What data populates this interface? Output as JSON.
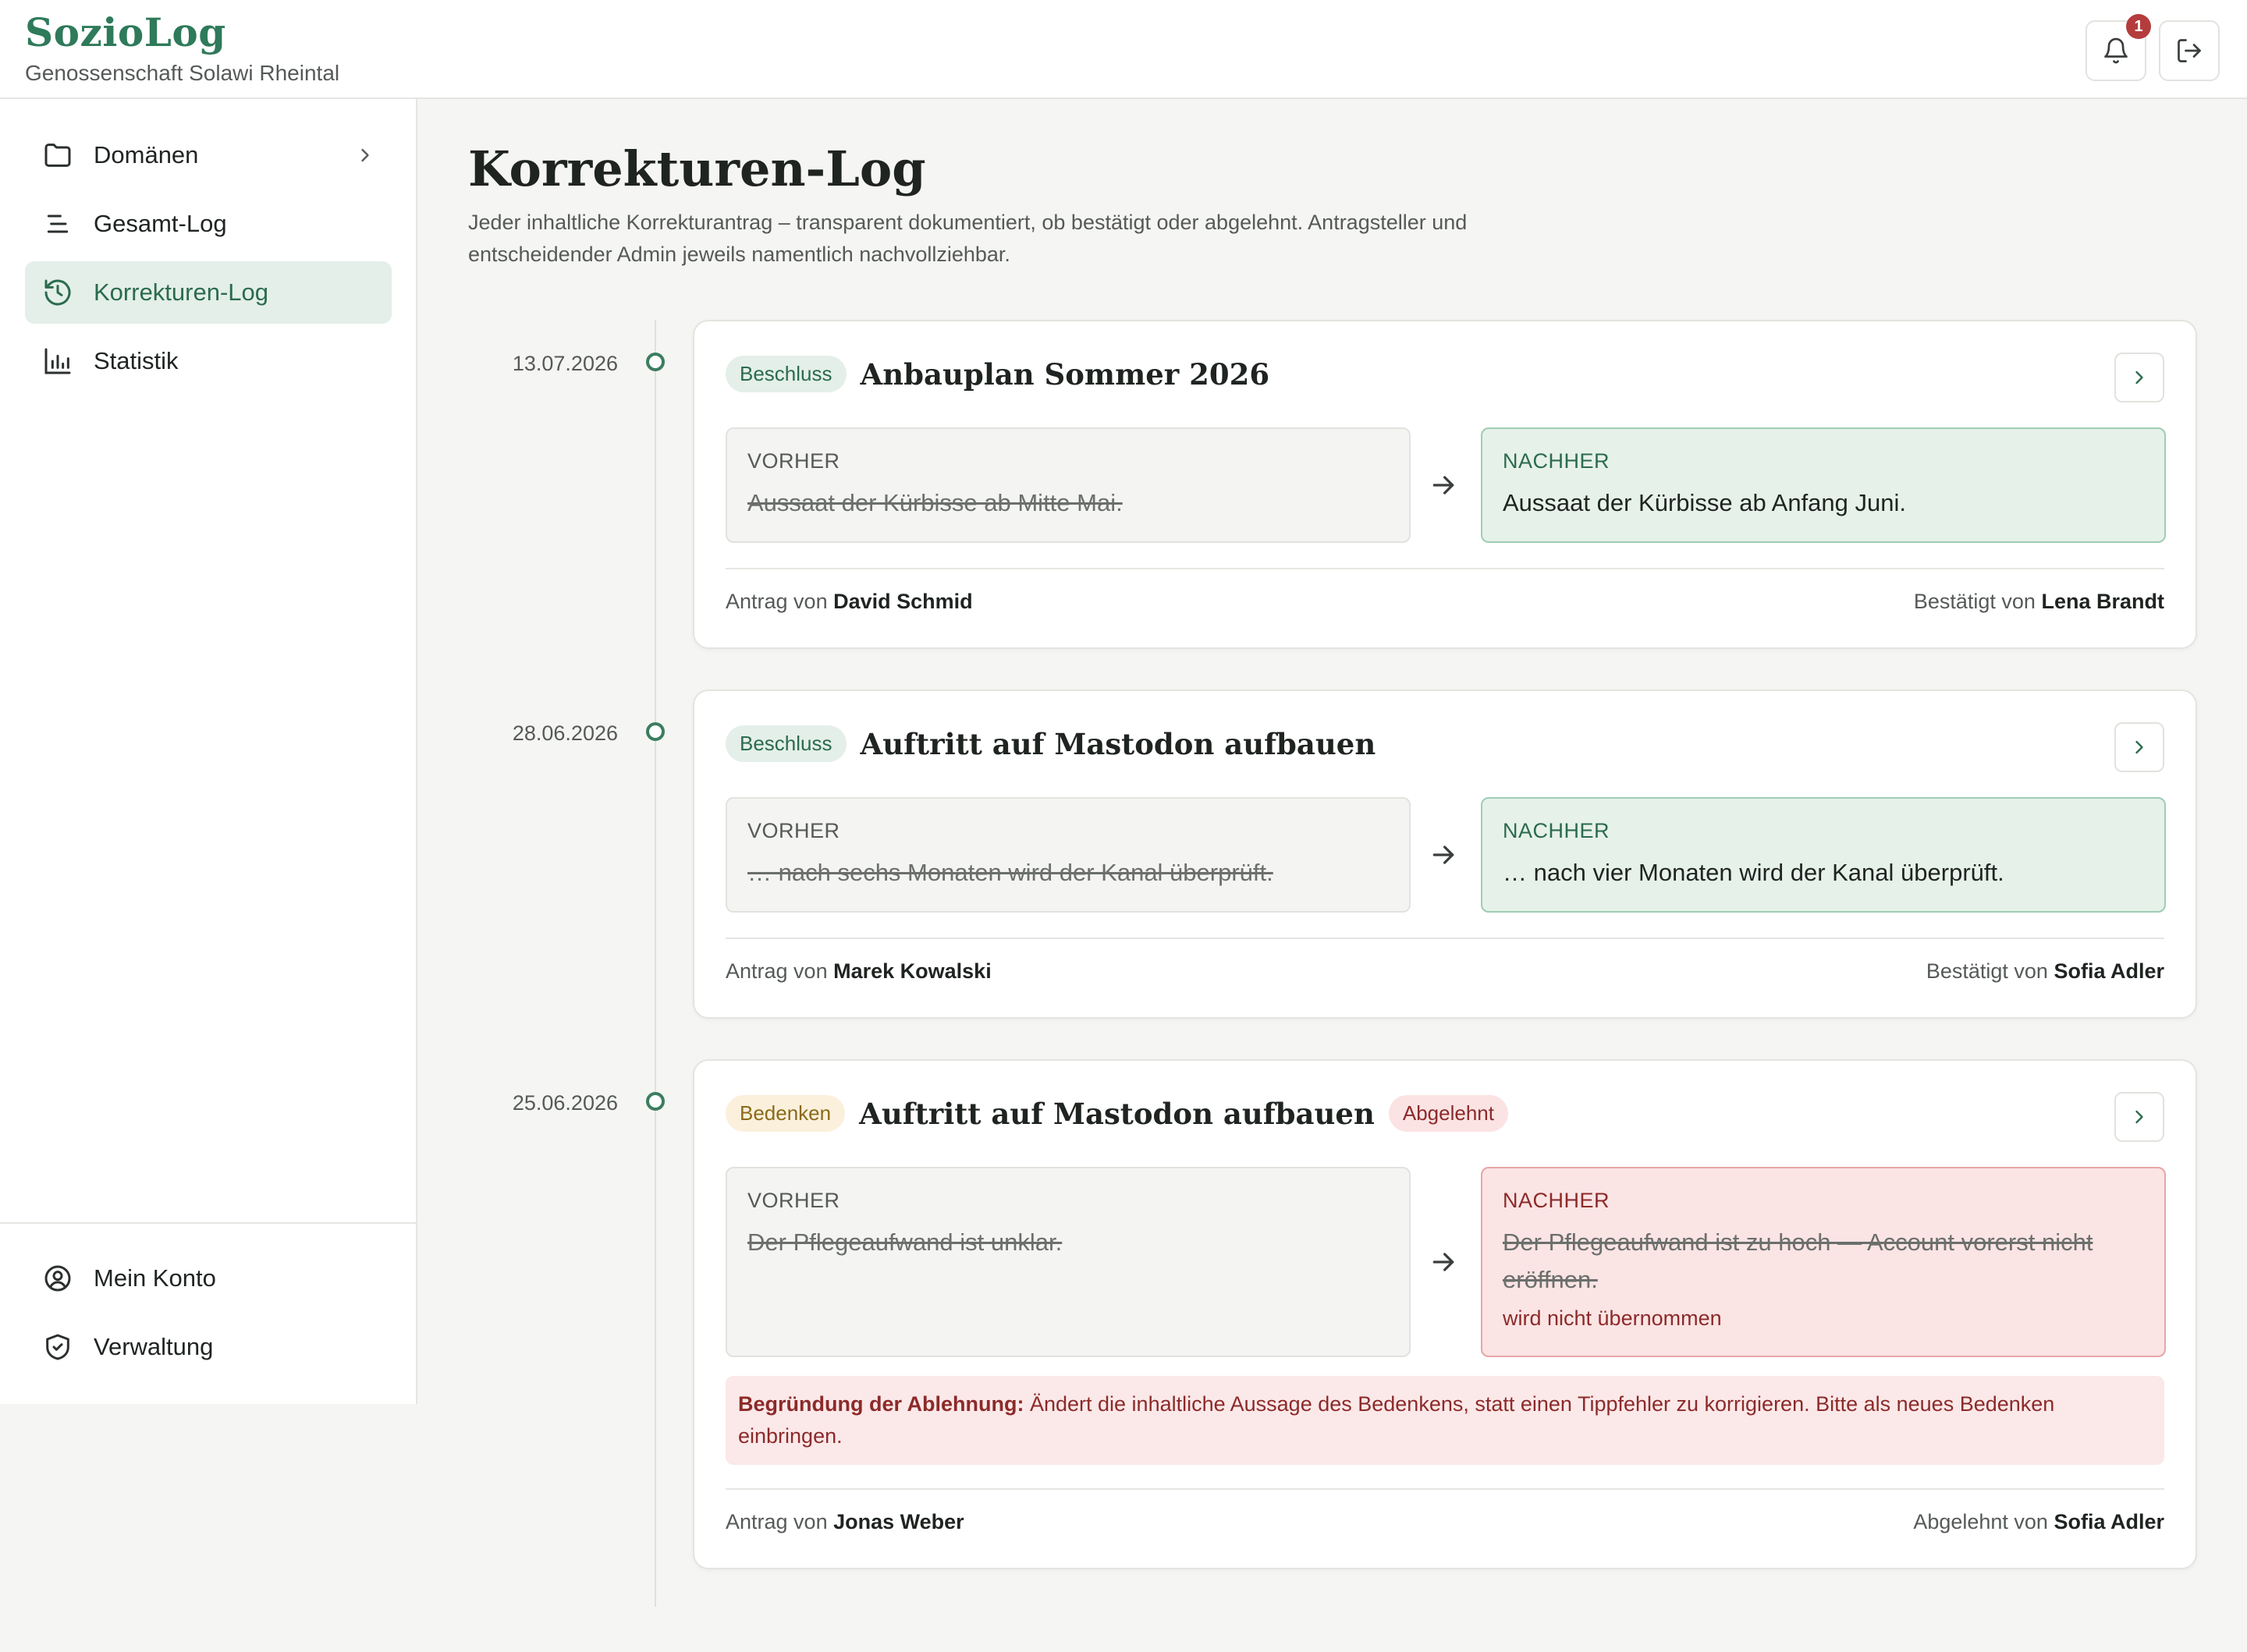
{
  "app": {
    "name": "SozioLog",
    "organization": "Genossenschaft Solawi Rheintal",
    "notification_count": "1"
  },
  "sidebar": {
    "items": [
      {
        "label": "Domänen",
        "icon": "folder-icon"
      },
      {
        "label": "Gesamt-Log",
        "icon": "list-lines-icon"
      },
      {
        "label": "Korrekturen-Log",
        "icon": "history-icon",
        "active": true
      },
      {
        "label": "Statistik",
        "icon": "bar-chart-icon"
      }
    ],
    "bottom_items": [
      {
        "label": "Mein Konto",
        "icon": "user-circle-icon"
      },
      {
        "label": "Verwaltung",
        "icon": "shield-check-icon"
      }
    ]
  },
  "main": {
    "title": "Korrekturen-Log",
    "description": "Jeder inhaltliche Korrekturantrag – transparent dokumentiert, ob bestätigt oder abgelehnt. Antragsteller und entscheidender Admin jeweils namentlich nachvollziehbar.",
    "labels": {
      "before": "VORHER",
      "after": "NACHHER",
      "requested_by": "Antrag von",
      "confirmed_by": "Bestätigt von",
      "rejected_by": "Abgelehnt von",
      "not_applied": "wird nicht übernommen",
      "rejection_reason_label": "Begründung der Ablehnung:"
    },
    "entries": [
      {
        "date": "13.07.2026",
        "type": "Beschluss",
        "title": "Anbauplan Sommer 2026",
        "before": "Aussaat der Kürbisse ab Mitte Mai.",
        "after": "Aussaat der Kürbisse ab Anfang Juni.",
        "requester": "David Schmid",
        "decider": "Lena Brandt",
        "status": "confirmed"
      },
      {
        "date": "28.06.2026",
        "type": "Beschluss",
        "title": "Auftritt auf Mastodon aufbauen",
        "before": "… nach sechs Monaten wird der Kanal überprüft.",
        "after": "… nach vier Monaten wird der Kanal überprüft.",
        "requester": "Marek Kowalski",
        "decider": "Sofia Adler",
        "status": "confirmed"
      },
      {
        "date": "25.06.2026",
        "type": "Bedenken",
        "title": "Auftritt auf Mastodon aufbauen",
        "status_badge": "Abgelehnt",
        "before": "Der Pflegeaufwand ist unklar.",
        "after": "Der Pflegeaufwand ist zu hoch — Account vorerst nicht eröffnen.",
        "rejection_reason": "Ändert die inhaltliche Aussage des Bedenkens, statt einen Tippfehler zu korrigieren. Bitte als neues Bedenken einbringen.",
        "requester": "Jonas Weber",
        "decider": "Sofia Adler",
        "status": "rejected"
      }
    ]
  },
  "colors": {
    "brand": "#2e7a5a",
    "active_bg": "#e4efe9",
    "confirmed_bg": "#e6f1ea",
    "rejected_bg": "#fbe4e4",
    "badge_red": "#b43c3c"
  }
}
